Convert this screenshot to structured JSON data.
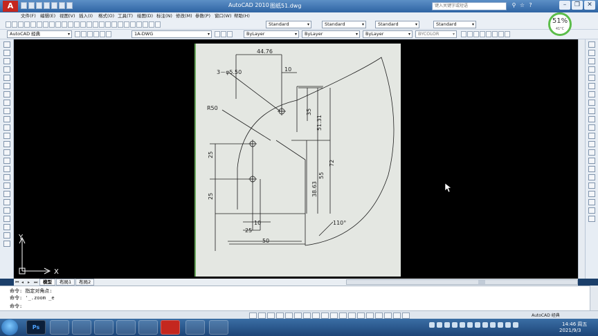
{
  "window": {
    "app_title": "AutoCAD 2010",
    "file_name": "图纸51.dwg",
    "search_placeholder": "键入关键字或短语",
    "logo_letter": "A"
  },
  "menu": [
    "文件(F)",
    "编辑(E)",
    "视图(V)",
    "插入(I)",
    "格式(O)",
    "工具(T)",
    "绘图(D)",
    "标注(N)",
    "修改(M)",
    "参数(P)",
    "窗口(W)",
    "帮助(H)"
  ],
  "toolbar1": {
    "text_style": "Standard",
    "dim_style": "Standard",
    "table_style": "Standard",
    "multileader_style": "Standard"
  },
  "toolbar2": {
    "workspace": "AutoCAD 经典",
    "layer": "1A-DWG",
    "color": "ByLayer",
    "linetype": "ByLayer",
    "lineweight": "ByLayer",
    "plotstyle": "BYCOLOR"
  },
  "gauge": {
    "percent": "51%",
    "temperature": "41°C",
    "fill_fraction": 0.51
  },
  "ucs": {
    "x_label": "X",
    "y_label": "Y"
  },
  "drawing": {
    "dims": {
      "d1": "44.76",
      "d2": "3－φ5.50",
      "d3": "10",
      "d4": "R50",
      "d5": "35",
      "d6": "51.31",
      "d7": "25",
      "d8": "72",
      "d9": "55",
      "d10": "38.63",
      "d11": "25",
      "d12": "10",
      "d13": "25",
      "d14": "50",
      "d15": "110°"
    }
  },
  "layout_tabs": {
    "model": "模型",
    "layout1": "布局1",
    "layout2": "布局2"
  },
  "command": {
    "line1": "命令: 指定对角点:",
    "line2": "命令: '_.zoom _e",
    "line3": "命令:"
  },
  "status": {
    "model_label": "AutoCAD 经典"
  },
  "taskbar": {
    "time": "14:46 周五",
    "date": "2021/9/3",
    "ps_label": "Ps"
  }
}
